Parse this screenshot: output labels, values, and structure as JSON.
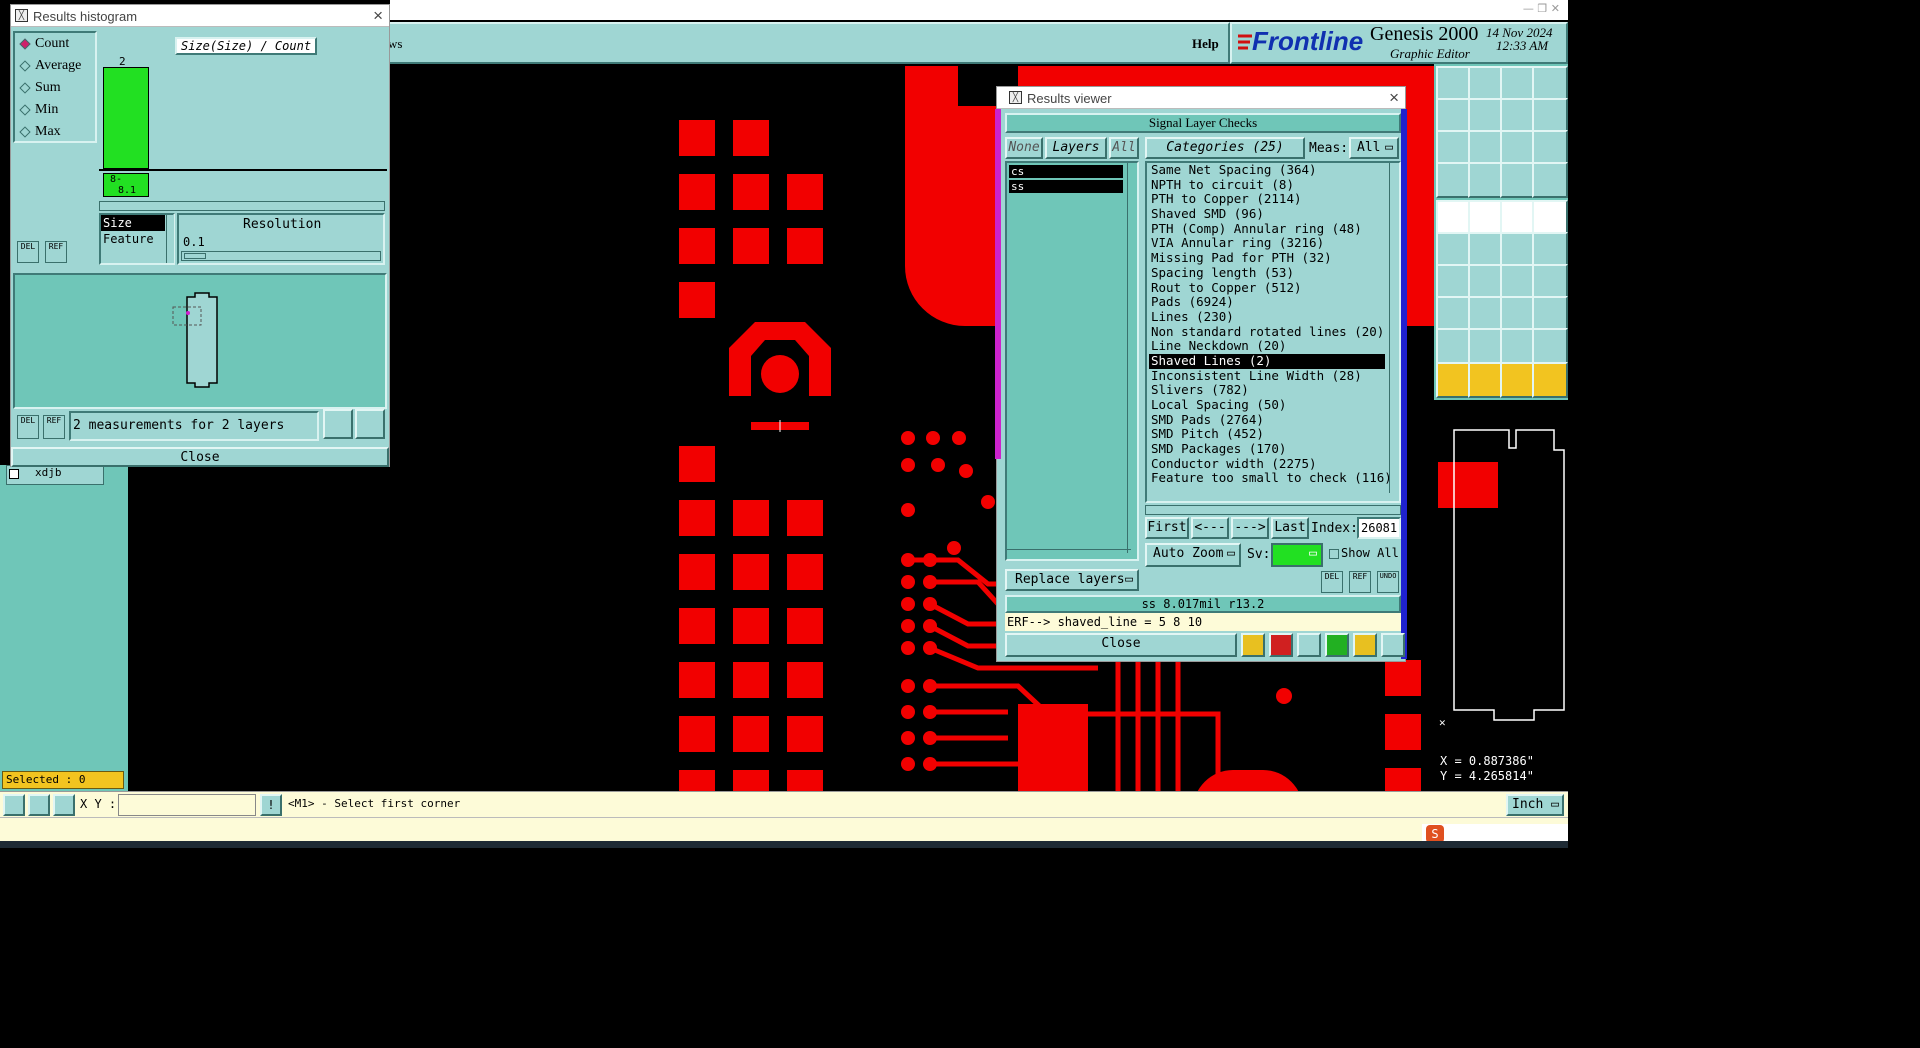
{
  "topbar": {
    "menu_partial": "ws",
    "help_label": "Help",
    "brand": "Frontline",
    "product": "Genesis 2000",
    "subtitle": "Graphic Editor",
    "date": "14 Nov 2024",
    "time": "12:33 AM"
  },
  "left_panel": {
    "tree_item": "xdjb",
    "selected_label": "Selected : 0"
  },
  "histogram": {
    "title": "Results histogram",
    "modes": [
      "Count",
      "Average",
      "Sum",
      "Min",
      "Max"
    ],
    "selected_mode": "Count",
    "axis_title": "Size(Size) / Count",
    "bar_count_label": "2",
    "bar_range_label1": "8-",
    "bar_range_label2": "8.1",
    "list_items": [
      "Size",
      "Feature"
    ],
    "resolution_label": "Resolution",
    "resolution_value": "0.1",
    "del_label": "DEL",
    "ref_label": "REF",
    "status": "2 measurements for 2 layers",
    "close_label": "Close"
  },
  "results_viewer": {
    "title": "Results viewer",
    "header": "Signal Layer Checks",
    "none_btn": "None",
    "layers_btn": "Layers",
    "all_btn": "All",
    "categories_btn": "Categories (25)",
    "meas_label": "Meas:",
    "meas_value": "All",
    "layers": [
      "cs",
      "ss"
    ],
    "categories": [
      "Same Net Spacing (364)",
      "NPTH to circuit (8)",
      "PTH to Copper (2114)",
      "Shaved SMD (96)",
      "PTH (Comp) Annular ring (48)",
      "VIA Annular ring (3216)",
      "Missing Pad for PTH (32)",
      "Spacing length (53)",
      "Rout to Copper (512)",
      "Pads (6924)",
      "Lines (230)",
      "Non standard rotated lines (20)",
      "Line Neckdown (20)",
      "Shaved Lines (2)",
      "Inconsistent Line Width (28)",
      "Slivers (782)",
      "Local Spacing (50)",
      "SMD Pads (2764)",
      "SMD Pitch (452)",
      "SMD Packages (170)",
      "Conductor width (2275)",
      "Feature too small to check (116)"
    ],
    "selected_category": "Shaved Lines (2)",
    "first_btn": "First",
    "prev_btn": "<---",
    "next_btn": "--->",
    "last_btn": "Last",
    "index_label": "Index:",
    "index_value": "26081",
    "auto_zoom": "Auto Zoom",
    "sv_label": "Sv:",
    "show_all": "Show All",
    "replace_layers": "Replace layers",
    "del_label": "DEL",
    "ref_label": "REF",
    "undo_label": "UNDO",
    "measure_text": "ss 8.017mil  r13.2",
    "erf_text": "ERF--> shaved_line = 5 8 10",
    "close_label": "Close"
  },
  "coords": {
    "x": "X = 0.887386\"",
    "y": "Y = 4.265814\""
  },
  "bottom": {
    "xy_label": "X Y :",
    "xy_value": "",
    "prompt": "<M1> - Select first corner",
    "units": "Inch"
  },
  "colors": {
    "teal": "#9fd6d3",
    "copper": "#f20000",
    "green": "#22e022",
    "highlight": "#000000"
  }
}
